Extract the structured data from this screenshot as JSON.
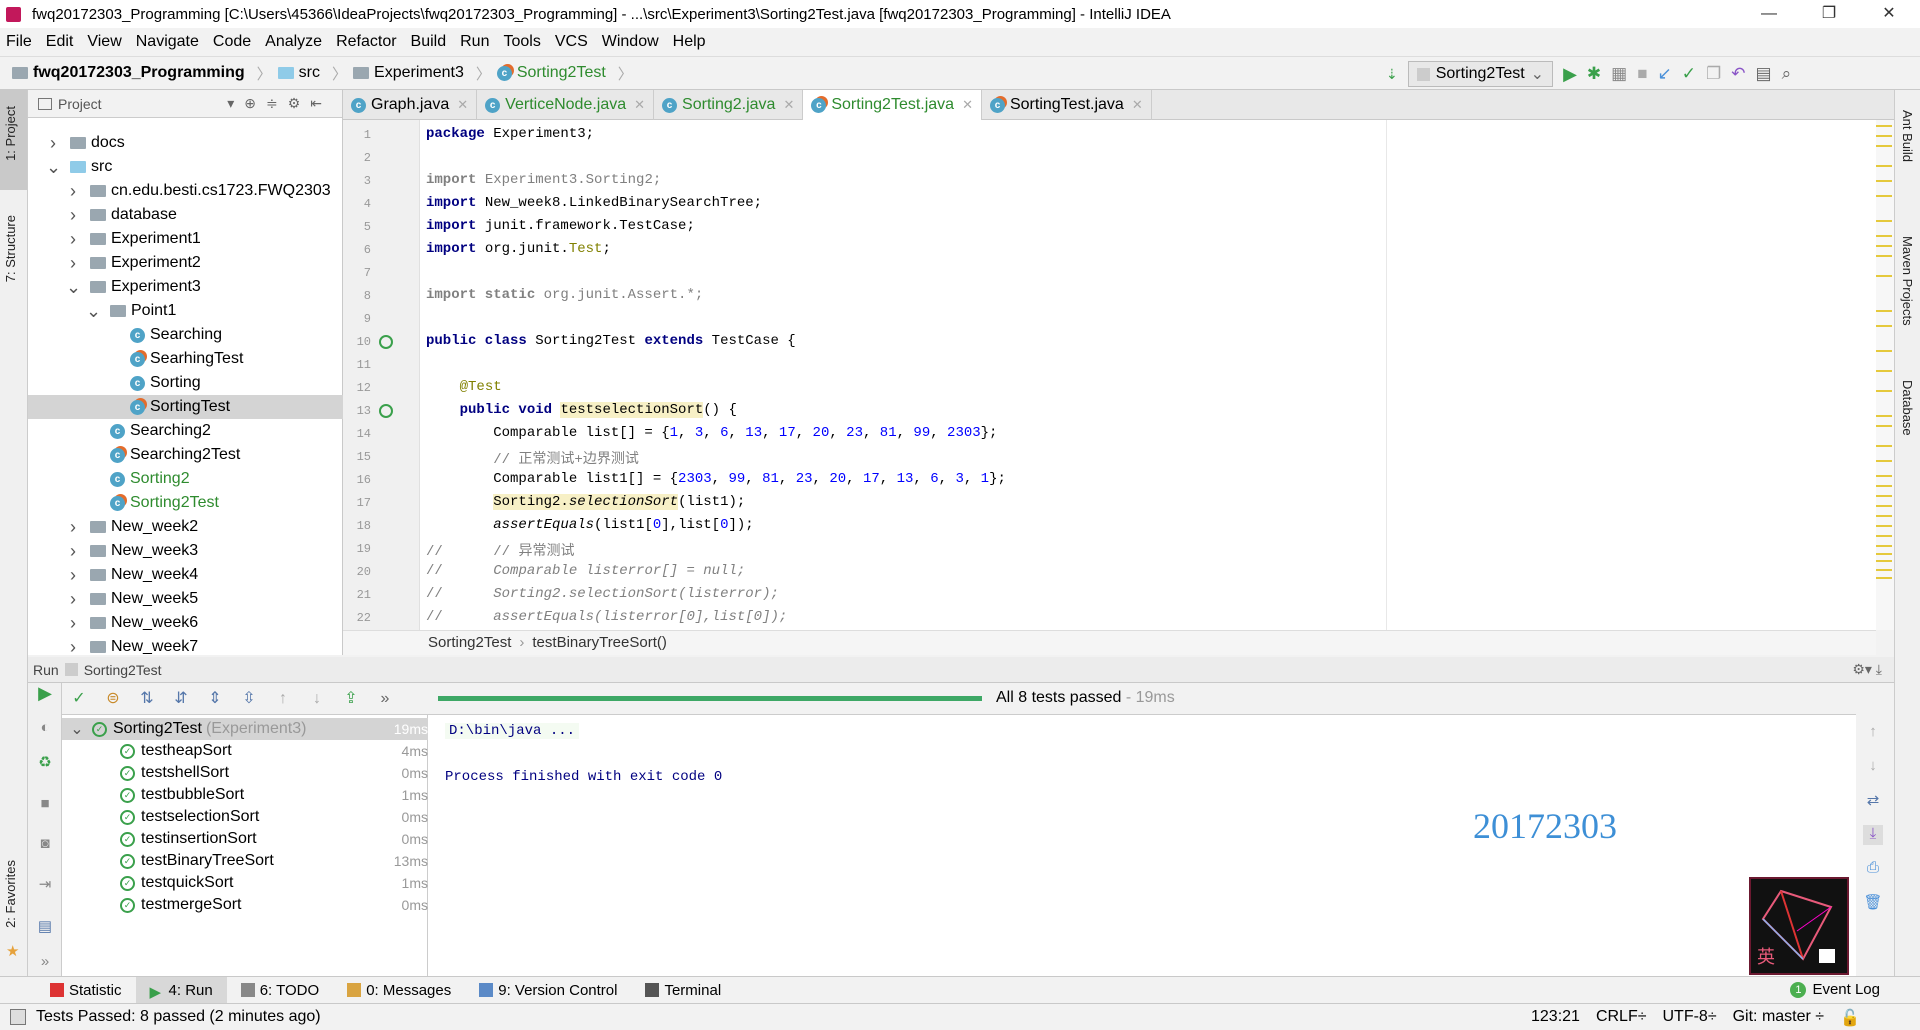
{
  "window": {
    "title": "fwq20172303_Programming [C:\\Users\\45366\\IdeaProjects\\fwq20172303_Programming] - ...\\src\\Experiment3\\Sorting2Test.java [fwq20172303_Programming] - IntelliJ IDEA",
    "minimize": "—",
    "restore": "❐",
    "close": "✕"
  },
  "menu": [
    "File",
    "Edit",
    "View",
    "Navigate",
    "Code",
    "Analyze",
    "Refactor",
    "Build",
    "Run",
    "Tools",
    "VCS",
    "Window",
    "Help"
  ],
  "breadcrumb": [
    "fwq20172303_Programming",
    "src",
    "Experiment3",
    "Sorting2Test"
  ],
  "run_config": "Sorting2Test",
  "left_strip": {
    "project": "1: Project",
    "structure": "7: Structure",
    "favorites": "2: Favorites"
  },
  "right_strip": {
    "ant": "Ant Build",
    "maven": "Maven Projects",
    "database": "Database"
  },
  "project_panel": {
    "title": "Project",
    "tree": [
      {
        "label": "docs",
        "depth": 1,
        "type": "folder",
        "arrow": "›"
      },
      {
        "label": "src",
        "depth": 1,
        "type": "src",
        "arrow": "⌄"
      },
      {
        "label": "cn.edu.besti.cs1723.FWQ2303",
        "depth": 2,
        "type": "folder",
        "arrow": "›"
      },
      {
        "label": "database",
        "depth": 2,
        "type": "folder",
        "arrow": "›"
      },
      {
        "label": "Experiment1",
        "depth": 2,
        "type": "folder",
        "arrow": "›"
      },
      {
        "label": "Experiment2",
        "depth": 2,
        "type": "folder",
        "arrow": "›"
      },
      {
        "label": "Experiment3",
        "depth": 2,
        "type": "folder",
        "arrow": "⌄"
      },
      {
        "label": "Point1",
        "depth": 3,
        "type": "folder",
        "arrow": "⌄"
      },
      {
        "label": "Searching",
        "depth": 4,
        "type": "class"
      },
      {
        "label": "SearhingTest",
        "depth": 4,
        "type": "test"
      },
      {
        "label": "Sorting",
        "depth": 4,
        "type": "class"
      },
      {
        "label": "SortingTest",
        "depth": 4,
        "type": "test",
        "selected": true
      },
      {
        "label": "Searching2",
        "depth": 3,
        "type": "class"
      },
      {
        "label": "Searching2Test",
        "depth": 3,
        "type": "test"
      },
      {
        "label": "Sorting2",
        "depth": 3,
        "type": "class",
        "modified": true
      },
      {
        "label": "Sorting2Test",
        "depth": 3,
        "type": "test",
        "modified": true
      },
      {
        "label": "New_week2",
        "depth": 2,
        "type": "folder",
        "arrow": "›"
      },
      {
        "label": "New_week3",
        "depth": 2,
        "type": "folder",
        "arrow": "›"
      },
      {
        "label": "New_week4",
        "depth": 2,
        "type": "folder",
        "arrow": "›"
      },
      {
        "label": "New_week5",
        "depth": 2,
        "type": "folder",
        "arrow": "›"
      },
      {
        "label": "New_week6",
        "depth": 2,
        "type": "folder",
        "arrow": "›"
      },
      {
        "label": "New_week7",
        "depth": 2,
        "type": "folder",
        "arrow": "›"
      }
    ]
  },
  "tabs": [
    {
      "label": "Graph.java",
      "active": false,
      "modified": false
    },
    {
      "label": "VerticeNode.java",
      "active": false,
      "modified": true
    },
    {
      "label": "Sorting2.java",
      "active": false,
      "modified": true
    },
    {
      "label": "Sorting2Test.java",
      "active": true,
      "modified": true
    },
    {
      "label": "SortingTest.java",
      "active": false,
      "modified": false
    }
  ],
  "code_lines": [
    "<span class='kw'>package</span> Experiment3;",
    "",
    "<span class='gr'><b>import</b> Experiment3.Sorting2;</span>",
    "<span class='kw'>import</span> New_week8.LinkedBinarySearchTree;",
    "<span class='kw'>import</span> junit.framework.TestCase;",
    "<span class='kw'>import</span> org.junit.<span class='ann'>Test</span>;",
    "",
    "<span class='gr'><b>import static</b> org.junit.Assert.*;</span>",
    "",
    "<span class='kw'>public class</span> Sorting2Test <span class='kw'>extends</span> TestCase {",
    "",
    "    <span class='ann'>@Test</span>",
    "    <span class='kw'>public void</span> <span class='hl'>testselectionSort</span>() {",
    "        Comparable list[] = {<span class='num'>1</span>, <span class='num'>3</span>, <span class='num'>6</span>, <span class='num'>13</span>, <span class='num'>17</span>, <span class='num'>20</span>, <span class='num'>23</span>, <span class='num'>81</span>, <span class='num'>99</span>, <span class='num'>2303</span>};",
    "        <span class='gr'>// 正常测试+边界测试</span>",
    "        Comparable list1[] = {<span class='num'>2303</span>, <span class='num'>99</span>, <span class='num'>81</span>, <span class='num'>23</span>, <span class='num'>20</span>, <span class='num'>17</span>, <span class='num'>13</span>, <span class='num'>6</span>, <span class='num'>3</span>, <span class='num'>1</span>};",
    "        <span class='hl'>Sorting2.<i>selectionSort</i></span>(list1);",
    "        <i>assertEquals</i>(list1[<span class='num'>0</span>],list[<span class='num'>0</span>]);",
    "<span class='gr'>//</span>      <span class='gr'>// 异常测试</span>",
    "<span class='gr'>//</span>      <span class='cm'>Comparable listerror[] = null;</span>",
    "<span class='gr'>//</span>      <span class='cm'>Sorting2.selectionSort(listerror);</span>",
    "<span class='gr'>//</span>      <span class='cm'>assertEquals(listerror[0],list[0]);</span>"
  ],
  "editor_breadcrumb": [
    "Sorting2Test",
    "testBinaryTreeSort()"
  ],
  "run": {
    "label": "Run",
    "config": "Sorting2Test",
    "status": "All 8 tests passed",
    "duration": " - 19ms",
    "progress_percent": 100,
    "root": {
      "name": "Sorting2Test",
      "pkg": "(Experiment3)",
      "time": "19ms"
    },
    "tests": [
      {
        "name": "testheapSort",
        "time": "4ms"
      },
      {
        "name": "testshellSort",
        "time": "0ms"
      },
      {
        "name": "testbubbleSort",
        "time": "1ms"
      },
      {
        "name": "testselectionSort",
        "time": "0ms"
      },
      {
        "name": "testinsertionSort",
        "time": "0ms"
      },
      {
        "name": "testBinaryTreeSort",
        "time": "13ms"
      },
      {
        "name": "testquickSort",
        "time": "1ms"
      },
      {
        "name": "testmergeSort",
        "time": "0ms"
      }
    ],
    "console": [
      "D:\\bin\\java ...",
      "Process finished with exit code 0"
    ],
    "watermark": "20172303",
    "logo_text": "英"
  },
  "bottom_tabs": [
    {
      "label": "Statistic",
      "color": "#d33"
    },
    {
      "label": "4: Run",
      "active": true,
      "color": "#3aa04b"
    },
    {
      "label": "6: TODO",
      "color": "#888"
    },
    {
      "label": "0: Messages",
      "color": "#d9a441"
    },
    {
      "label": "9: Version Control",
      "color": "#5b8ac7"
    },
    {
      "label": "Terminal",
      "color": "#555"
    }
  ],
  "event_log": {
    "label": "Event Log",
    "count": "1"
  },
  "status": {
    "message": "Tests Passed: 8 passed (2 minutes ago)",
    "position": "123:21",
    "line_sep": "CRLF÷",
    "encoding": "UTF-8÷",
    "vcs": "Git: master ÷"
  },
  "colors": {
    "accent_green": "#3ea866",
    "keyword": "#000080",
    "number": "#0000ff",
    "watermark": "#3d8fd6"
  }
}
